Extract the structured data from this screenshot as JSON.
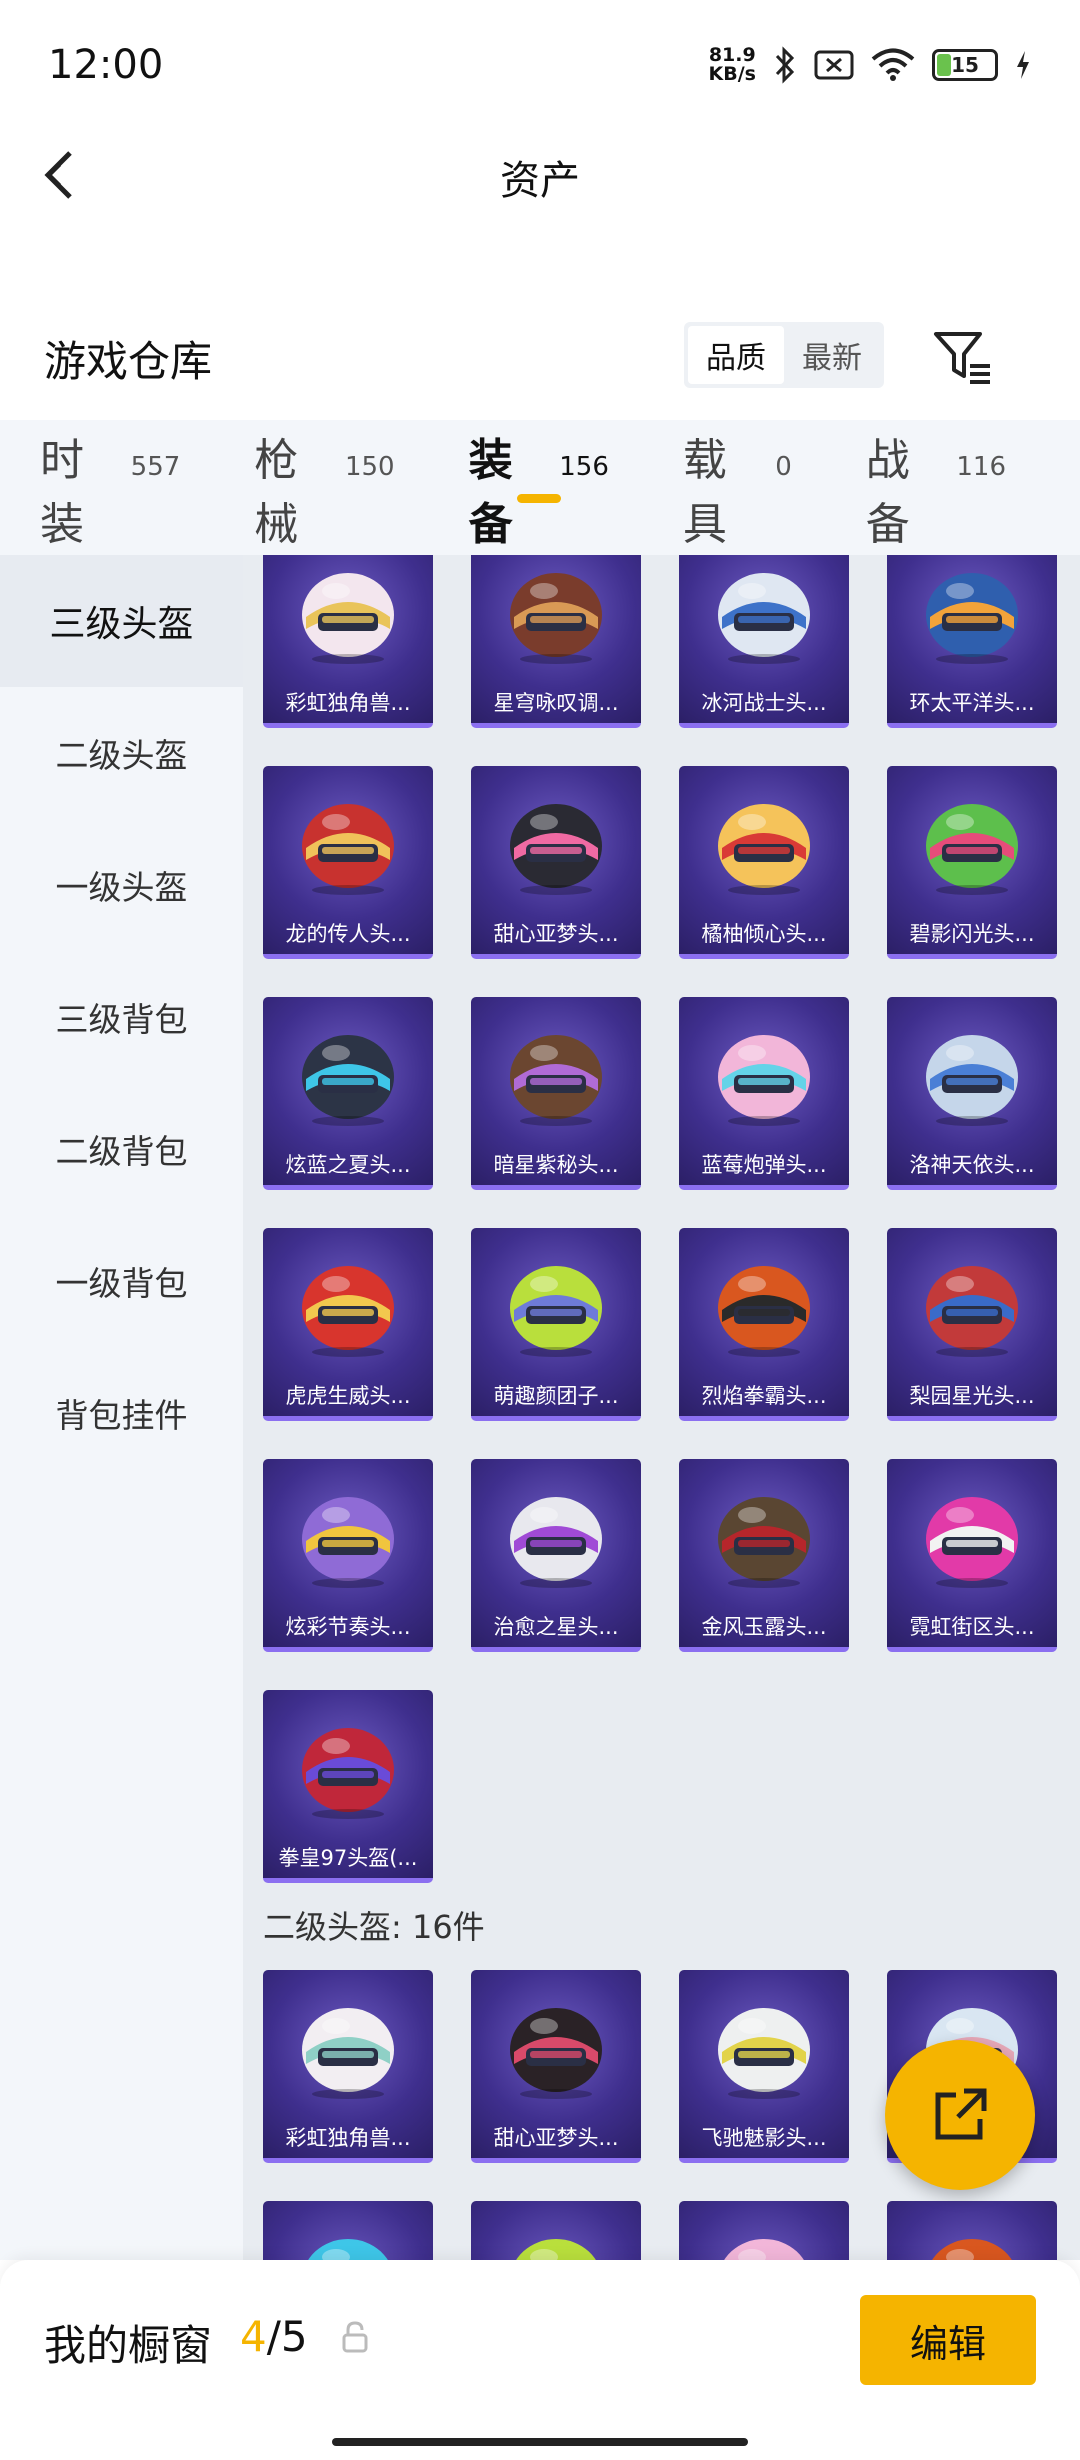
{
  "status_bar": {
    "time": "12:00",
    "net_speed_value": "81.9",
    "net_speed_unit": "KB/s",
    "battery": "15"
  },
  "header": {
    "title": "资产"
  },
  "warehouse": {
    "title": "游戏仓库",
    "sort_options": [
      "品质",
      "最新"
    ],
    "sort_selected": "品质"
  },
  "tabs": [
    {
      "label": "时装",
      "count": "557"
    },
    {
      "label": "枪械",
      "count": "150"
    },
    {
      "label": "装备",
      "count": "156"
    },
    {
      "label": "载具",
      "count": "0"
    },
    {
      "label": "战备",
      "count": "116"
    }
  ],
  "active_tab": "装备",
  "sidebar": [
    {
      "label": "三级头盔"
    },
    {
      "label": "二级头盔"
    },
    {
      "label": "一级头盔"
    },
    {
      "label": "三级背包"
    },
    {
      "label": "二级背包"
    },
    {
      "label": "一级背包"
    },
    {
      "label": "背包挂件"
    }
  ],
  "active_sidebar": "三级头盔",
  "level3_items": [
    {
      "name": "彩虹独角兽...",
      "color": "#f3e6ee",
      "accent": "#e9c45a"
    },
    {
      "name": "星穹咏叹调...",
      "color": "#7a3c2c",
      "accent": "#d99a55"
    },
    {
      "name": "冰河战士头...",
      "color": "#dfe7f2",
      "accent": "#3d72c9"
    },
    {
      "name": "环太平洋头...",
      "color": "#2f5fae",
      "accent": "#f2a33a"
    },
    {
      "name": "龙的传人头...",
      "color": "#c8322f",
      "accent": "#f0c25a"
    },
    {
      "name": "甜心亚梦头...",
      "color": "#2a2a33",
      "accent": "#f06aa3"
    },
    {
      "name": "橘柚倾心头...",
      "color": "#f5c35a",
      "accent": "#d93a36"
    },
    {
      "name": "碧影闪光头...",
      "color": "#5dbf4c",
      "accent": "#e64c7a"
    },
    {
      "name": "炫蓝之夏头...",
      "color": "#2c3446",
      "accent": "#3ec6e8"
    },
    {
      "name": "暗星紫秘头...",
      "color": "#6b4630",
      "accent": "#b06bd6"
    },
    {
      "name": "蓝莓炮弹头...",
      "color": "#f2b6d9",
      "accent": "#64d3e8"
    },
    {
      "name": "洛神天依头...",
      "color": "#c5d6ea",
      "accent": "#4a7fd6"
    },
    {
      "name": "虎虎生威头...",
      "color": "#d8352d",
      "accent": "#f2c84e"
    },
    {
      "name": "萌趣颜团子...",
      "color": "#b9df3c",
      "accent": "#6e7bd8"
    },
    {
      "name": "烈焰拳霸头...",
      "color": "#d9571f",
      "accent": "#2a2a2a"
    },
    {
      "name": "梨园星光头...",
      "color": "#c23a3a",
      "accent": "#3a6bc9"
    },
    {
      "name": "炫彩节奏头...",
      "color": "#8f6bd6",
      "accent": "#f0c53e"
    },
    {
      "name": "治愈之星头...",
      "color": "#e8e8ee",
      "accent": "#a04ad6"
    },
    {
      "name": "金风玉露头...",
      "color": "#5a4632",
      "accent": "#b6262b"
    },
    {
      "name": "霓虹街区头...",
      "color": "#e23aa8",
      "accent": "#f2f2f2"
    },
    {
      "name": "拳皇97头盔(...",
      "color": "#c0273a",
      "accent": "#6a4bd8"
    }
  ],
  "level2_section": {
    "label": "二级头盔: 16件"
  },
  "level2_items": [
    {
      "name": "彩虹独角兽...",
      "color": "#f2eef2",
      "accent": "#8fd0c6"
    },
    {
      "name": "甜心亚梦头...",
      "color": "#2a2226",
      "accent": "#d94a6a"
    },
    {
      "name": "飞驰魅影头...",
      "color": "#eef0f0",
      "accent": "#e2d34a"
    },
    {
      "name": "",
      "color": "#d9e6f2",
      "accent": "#e6a8b8"
    }
  ],
  "level2_row2": [
    {
      "name": "",
      "color": "#3ec6e8",
      "accent": "#2c3446"
    },
    {
      "name": "",
      "color": "#b9df3c",
      "accent": "#6e7bd8"
    },
    {
      "name": "",
      "color": "#f2b6d9",
      "accent": "#64d3e8"
    },
    {
      "name": "",
      "color": "#d9571f",
      "accent": "#2a2a2a"
    }
  ],
  "bottom_bar": {
    "label": "我的橱窗",
    "count_current": "4",
    "count_total": "/5",
    "edit_label": "编辑"
  }
}
